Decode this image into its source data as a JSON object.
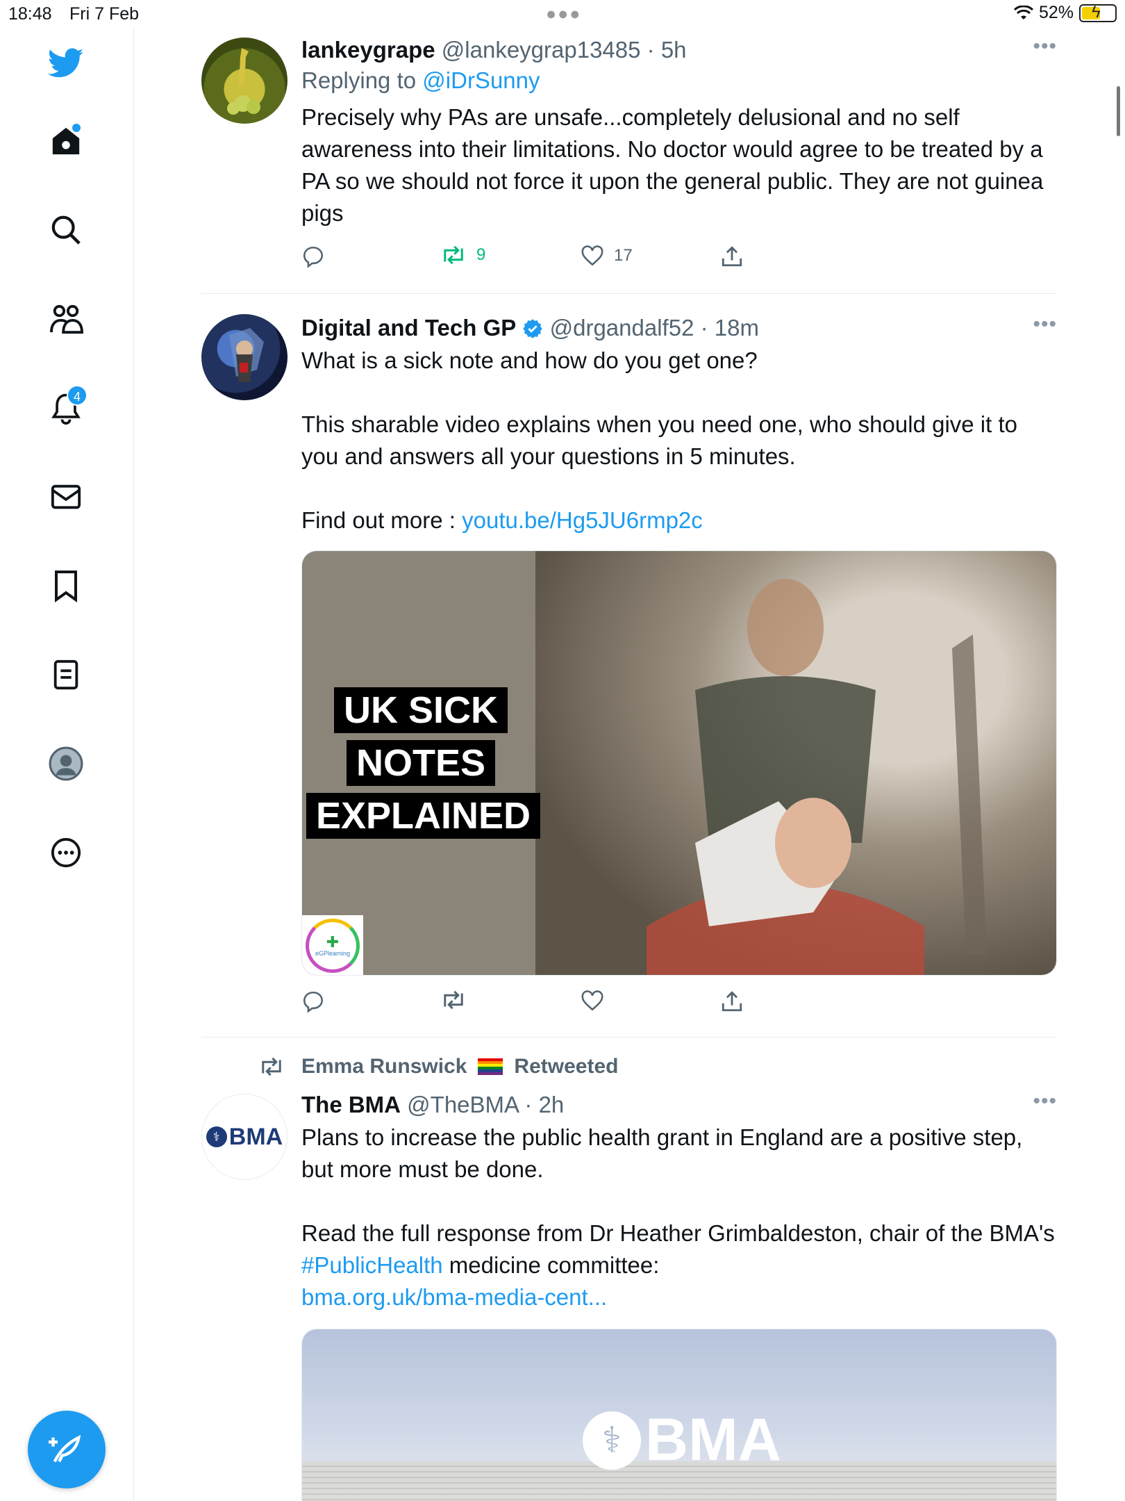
{
  "status_bar": {
    "time": "18:48",
    "date": "Fri 7 Feb",
    "battery": "52%"
  },
  "sidebar": {
    "notifications_badge": "4",
    "items": [
      "home-icon",
      "search-icon",
      "communities-icon",
      "notifications-icon",
      "messages-icon",
      "bookmarks-icon",
      "lists-icon",
      "profile-icon",
      "more-icon"
    ]
  },
  "tweets": [
    {
      "name": "lankeygrape",
      "handle": "@lankeygrap13485",
      "time": "· 5h",
      "replying_label": "Replying to",
      "replying_to": "@iDrSunny",
      "text": "Precisely why PAs are unsafe...completely delusional and no self awareness into their limitations. No doctor would agree to be treated by a PA so we should not force it upon the general public. They are not guinea pigs",
      "retweets": "9",
      "likes": "17"
    },
    {
      "name": "Digital and Tech GP",
      "handle": "@drgandalf52",
      "time": "· 18m",
      "text_line1": "What is a sick note and how do you get one?",
      "text_line2": "This sharable video explains when you need one, who should give it to you and answers all your questions in 5 minutes.",
      "text_line3_prefix": "Find out more :",
      "link": "youtu.be/Hg5JU6rmp2c",
      "media_title": [
        "UK SICK",
        "NOTES",
        "EXPLAINED"
      ],
      "media_logo_text": "eGPlearning"
    },
    {
      "retweeted_by": "Emma Runswick",
      "retweeted_label": "Retweeted",
      "name": "The BMA",
      "handle": "@TheBMA",
      "time": "· 2h",
      "avatar_text": "BMA",
      "text_line1": "Plans to increase the public health grant in England are a positive step, but more must be done.",
      "text_line2_a": "Read the full response from Dr Heather Grimbaldeston, chair of the BMA's",
      "hashtag": "#PublicHealth",
      "text_line2_b": "medicine committee:",
      "link": "bma.org.uk/bma-media-cent...",
      "media_logo_text": "BMA"
    }
  ],
  "colors": {
    "accent": "#1d9bf0",
    "retweet_green": "#00ba7c",
    "secondary_text": "#536471"
  }
}
